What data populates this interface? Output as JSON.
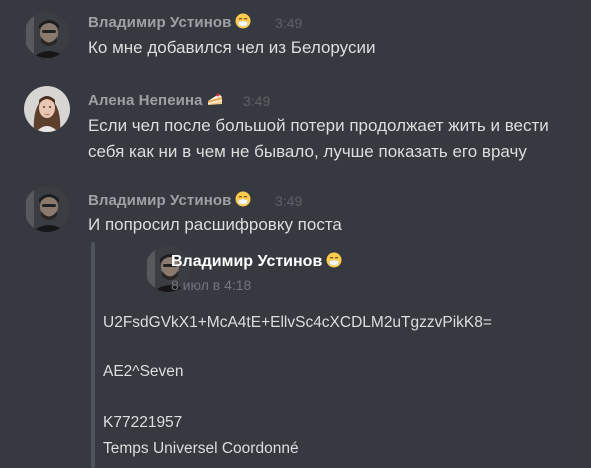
{
  "colors": {
    "background": "#36393f",
    "author_name": "#9ea0a5",
    "timestamp": "#5f6167",
    "message_text": "#dcddde",
    "embed_bar": "#4f545c",
    "embed_author": "#ffffff"
  },
  "messages": [
    {
      "author": "Владимир Устинов",
      "author_emoji": "face-with-medical-mask-emoji",
      "time": "3:49",
      "lines": [
        "Ко мне добавился чел из Белорусии"
      ]
    },
    {
      "author": "Алена Непеина",
      "author_emoji": "cake-slice-emoji",
      "time": "3:49",
      "lines": [
        "Если чел после большой потери продолжает жить и вести",
        "себя как ни в чем не бывало, лучше показать его врачу"
      ]
    },
    {
      "author": "Владимир Устинов",
      "author_emoji": "face-with-medical-mask-emoji",
      "time": "3:49",
      "lines": [
        "И попросил расшифровку поста"
      ]
    }
  ],
  "embed": {
    "author": "Владимир Устинов",
    "author_emoji": "face-with-medical-mask-emoji",
    "time": "8 июл в 4:18",
    "lines": [
      "U2FsdGVkX1+McA4tE+EllvSc4cXCDLM2uTgzzvPikK8=",
      "AE2^Seven",
      "K77221957",
      "Temps Universel Coordonné"
    ]
  }
}
